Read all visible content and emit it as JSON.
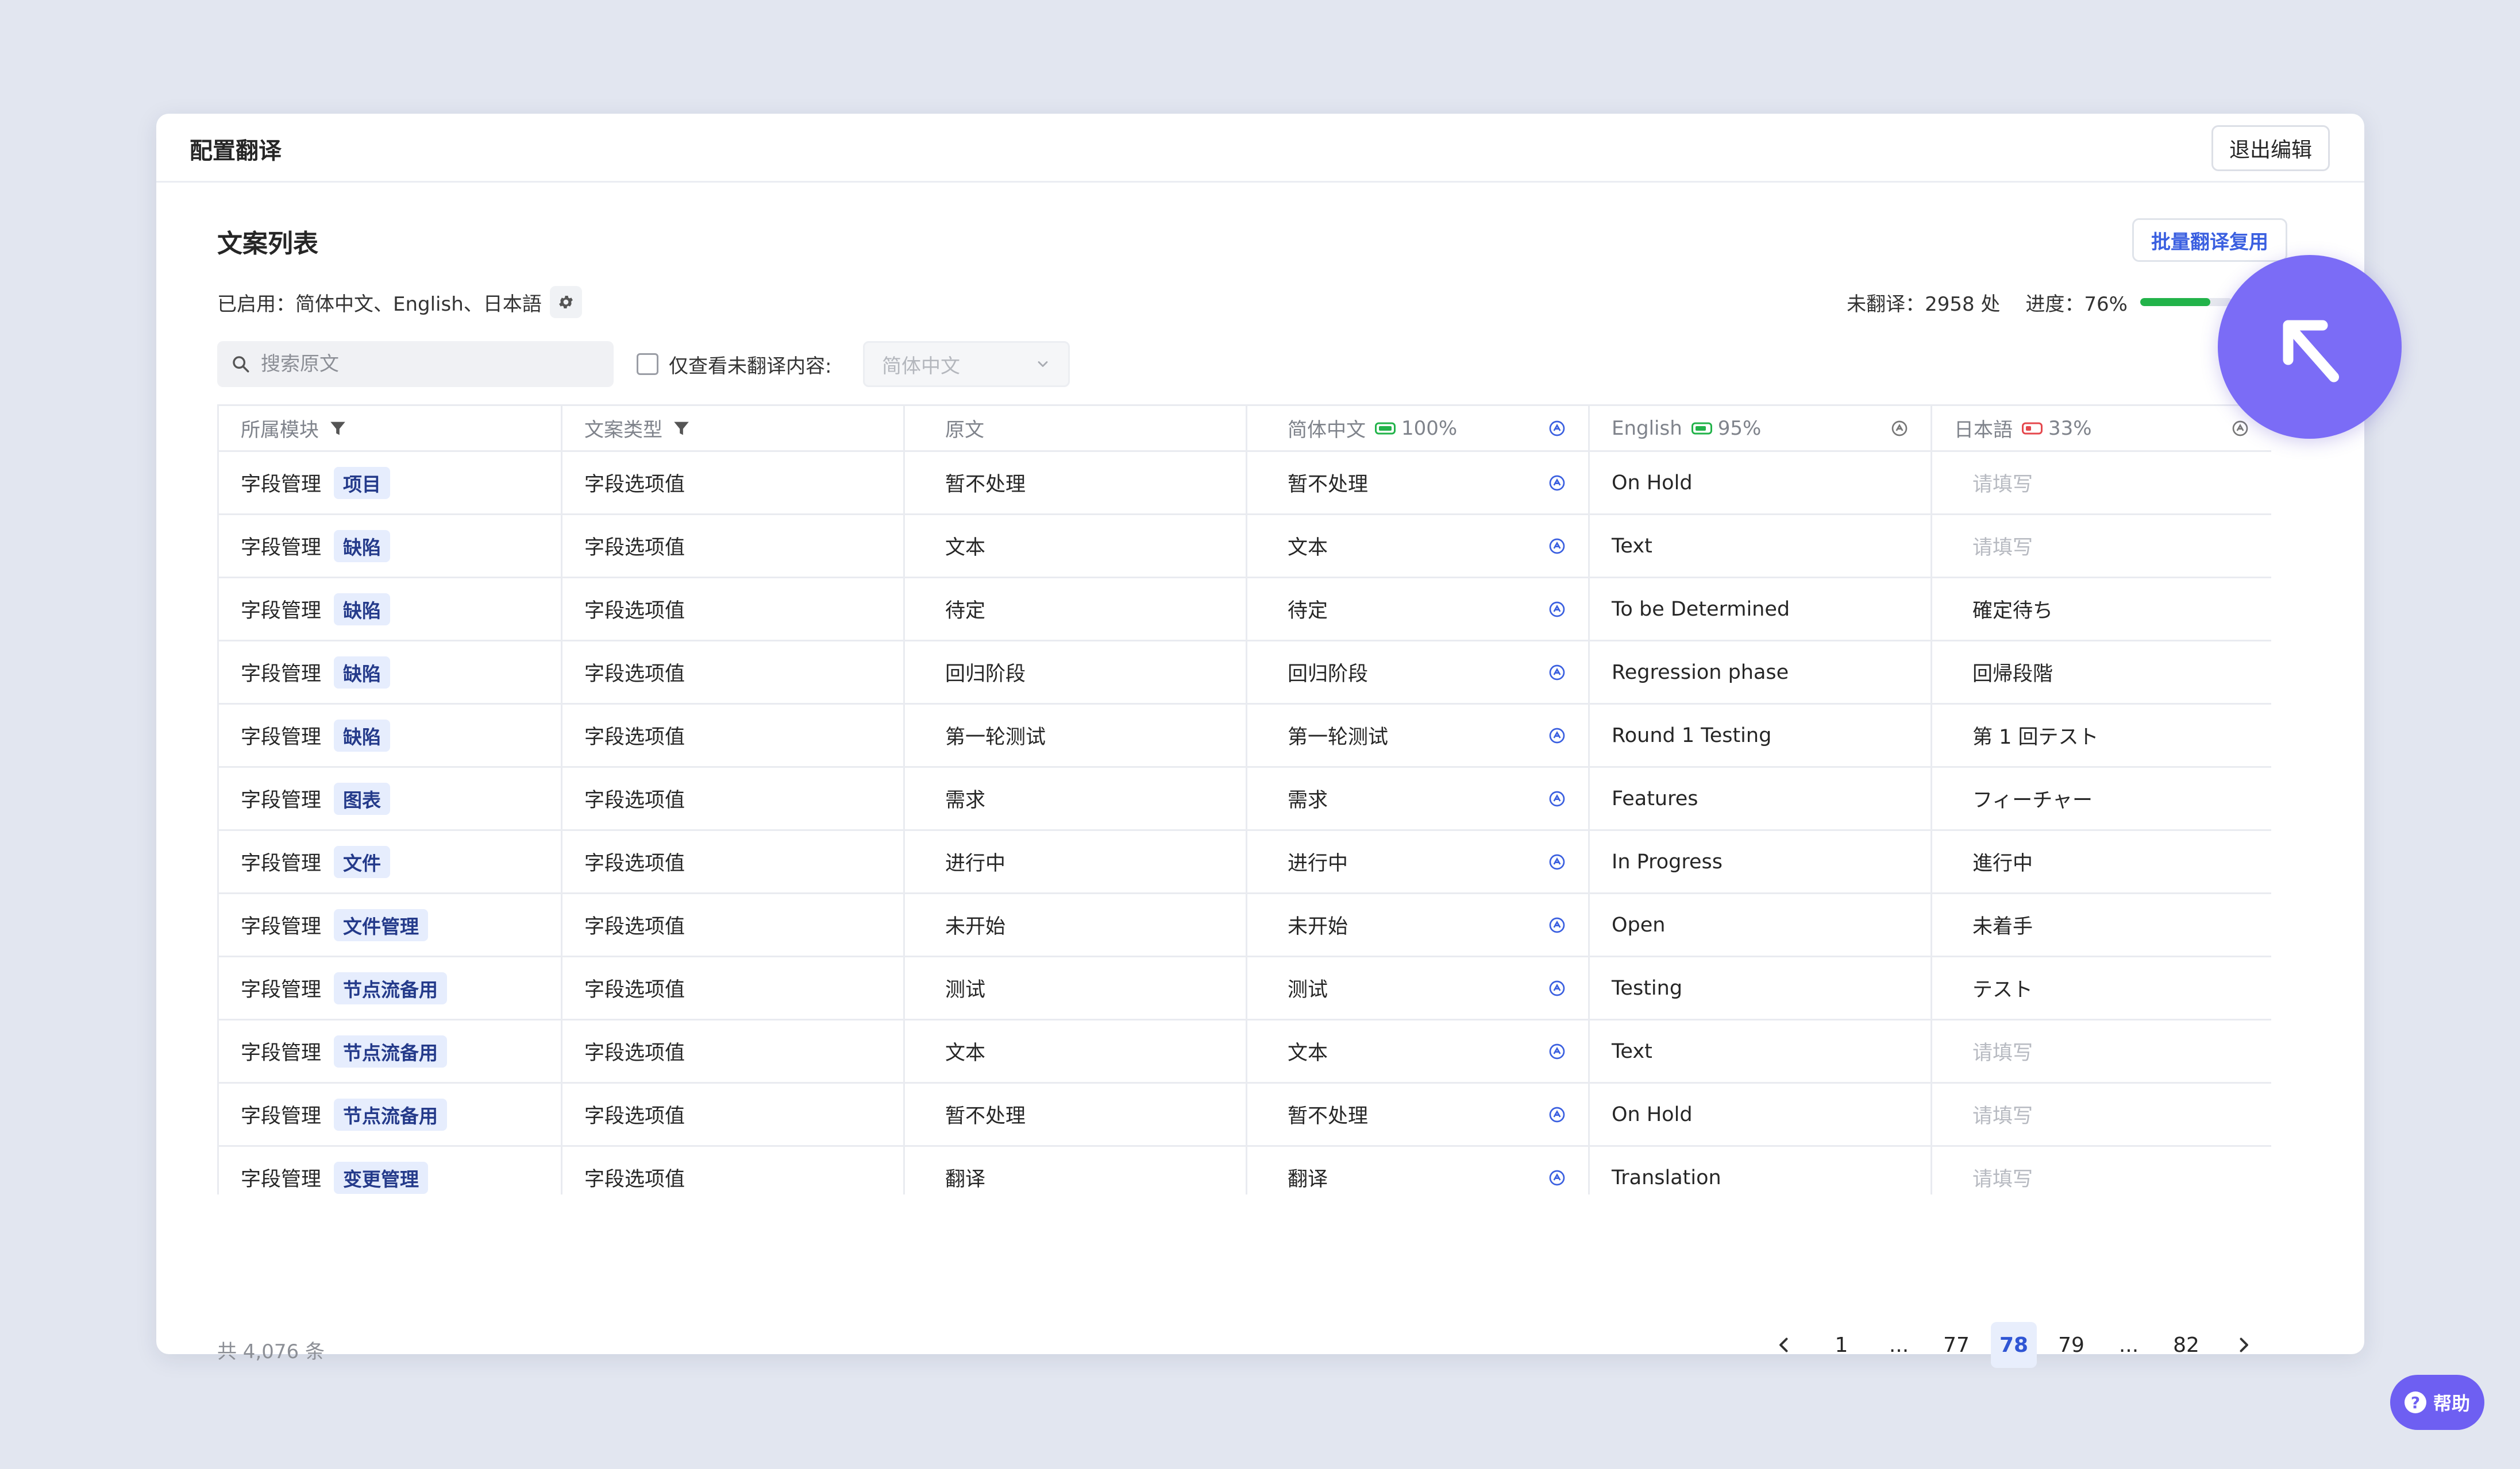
{
  "modal": {
    "title": "配置翻译",
    "exit_label": "退出编辑"
  },
  "section": {
    "title": "文案列表",
    "batch_label": "批量翻译复用",
    "enabled_text": "已启用：简体中文、English、日本語",
    "untranslated_text": "未翻译：2958 处",
    "progress_text": "进度：76%",
    "progress_value": 0.76,
    "progress_color": "#22b34a"
  },
  "filters": {
    "search_placeholder": "搜索原文",
    "untranslated_only_label": "仅查看未翻译内容:",
    "lang_select_value": "简体中文"
  },
  "table": {
    "headers": {
      "module": "所属模块",
      "type": "文案类型",
      "source": "原文",
      "zh": "简体中文",
      "zh_pct": "100%",
      "en": "English",
      "en_pct": "95%",
      "ja": "日本語",
      "ja_pct": "33%"
    },
    "placeholder": "请填写",
    "rows": [
      {
        "module": "字段管理",
        "tag": "项目",
        "type": "字段选项值",
        "source": "暂不处理",
        "zh": "暂不处理",
        "en": "On Hold",
        "ja": ""
      },
      {
        "module": "字段管理",
        "tag": "缺陷",
        "type": "字段选项值",
        "source": "文本",
        "zh": "文本",
        "en": "Text",
        "ja": ""
      },
      {
        "module": "字段管理",
        "tag": "缺陷",
        "type": "字段选项值",
        "source": "待定",
        "zh": "待定",
        "en": "To be Determined",
        "ja": "確定待ち"
      },
      {
        "module": "字段管理",
        "tag": "缺陷",
        "type": "字段选项值",
        "source": "回归阶段",
        "zh": "回归阶段",
        "en": "Regression phase",
        "ja": "回帰段階"
      },
      {
        "module": "字段管理",
        "tag": "缺陷",
        "type": "字段选项值",
        "source": "第一轮测试",
        "zh": "第一轮测试",
        "en": "Round 1 Testing",
        "ja": "第 1 回テスト"
      },
      {
        "module": "字段管理",
        "tag": "图表",
        "type": "字段选项值",
        "source": "需求",
        "zh": "需求",
        "en": "Features",
        "ja": "フィーチャー"
      },
      {
        "module": "字段管理",
        "tag": "文件",
        "type": "字段选项值",
        "source": "进行中",
        "zh": "进行中",
        "en": "In Progress",
        "ja": "進行中"
      },
      {
        "module": "字段管理",
        "tag": "文件管理",
        "type": "字段选项值",
        "source": "未开始",
        "zh": "未开始",
        "en": "Open",
        "ja": "未着手"
      },
      {
        "module": "字段管理",
        "tag": "节点流备用",
        "type": "字段选项值",
        "source": "测试",
        "zh": "测试",
        "en": "Testing",
        "ja": "テスト"
      },
      {
        "module": "字段管理",
        "tag": "节点流备用",
        "type": "字段选项值",
        "source": "文本",
        "zh": "文本",
        "en": "Text",
        "ja": ""
      },
      {
        "module": "字段管理",
        "tag": "节点流备用",
        "type": "字段选项值",
        "source": "暂不处理",
        "zh": "暂不处理",
        "en": "On Hold",
        "ja": ""
      },
      {
        "module": "字段管理",
        "tag": "变更管理",
        "type": "字段选项值",
        "source": "翻译",
        "zh": "翻译",
        "en": "Translation",
        "ja": ""
      }
    ]
  },
  "footer": {
    "total": "共 4,076 条",
    "pages": [
      "1",
      "...",
      "77",
      "78",
      "79",
      "...",
      "82"
    ],
    "active_page": "78"
  },
  "help": {
    "label": "帮助",
    "icon_glyph": "?"
  },
  "colors": {
    "accent": "#3a5fe0",
    "tag_bg": "#e6edfd",
    "help_bg": "#6e5ff2",
    "badge_green": "#22b34a",
    "badge_red": "#e5484d"
  }
}
